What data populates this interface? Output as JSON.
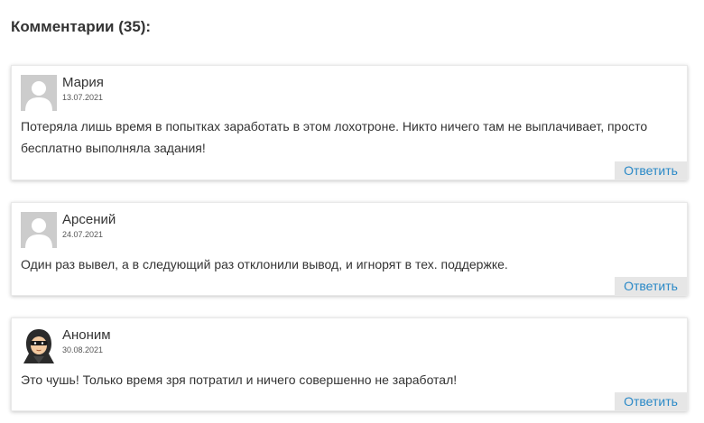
{
  "comments_section": {
    "title": "Комментарии (35):",
    "comments": [
      {
        "author": "Мария",
        "date": "13.07.2021",
        "text": "Потеряла лишь время в попытках заработать в этом лохотроне. Никто ничего там не выплачивает, просто бесплатно выполняла задания!",
        "reply_label": "Ответить",
        "avatar": "default-user-avatar-icon"
      },
      {
        "author": "Арсений",
        "date": "24.07.2021",
        "text": "Один раз вывел, а в следующий раз отклонили вывод, и игнорят в тех. поддержке.",
        "reply_label": "Ответить",
        "avatar": "default-user-avatar-icon"
      },
      {
        "author": "Аноним",
        "date": "30.08.2021",
        "text": "Это чушь! Только время зря потратил и ничего совершенно не заработал!",
        "reply_label": "Ответить",
        "avatar": "hooded-anonymous-avatar-icon"
      }
    ]
  },
  "colors": {
    "reply_text": "#2a89c7",
    "reply_bg": "#e6e6e6",
    "avatar_placeholder": "#cccccc"
  }
}
